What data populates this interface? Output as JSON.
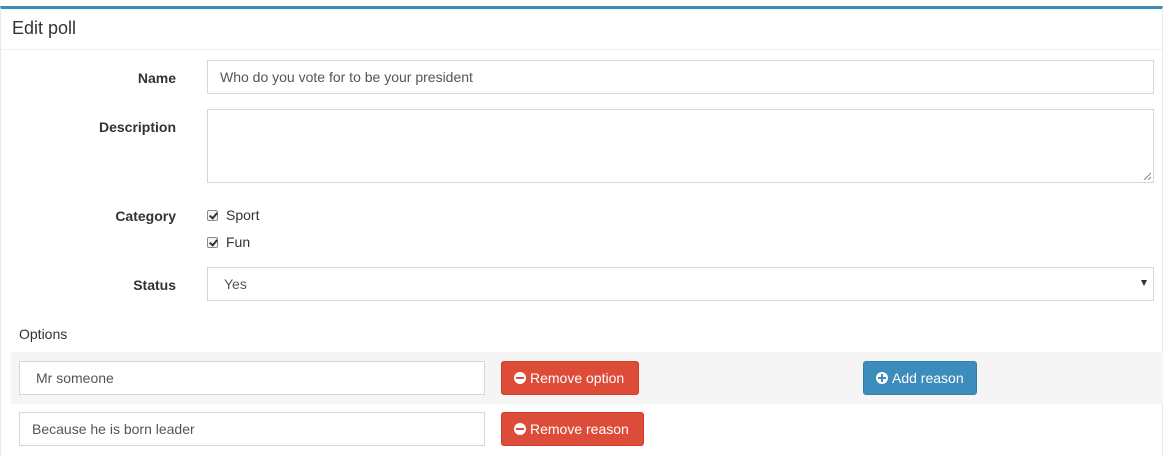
{
  "box": {
    "title": "Edit poll"
  },
  "form": {
    "name": {
      "label": "Name",
      "value": "Who do you vote for to be your president"
    },
    "description": {
      "label": "Description",
      "value": ""
    },
    "category": {
      "label": "Category",
      "options": [
        {
          "label": "Sport",
          "checked": true
        },
        {
          "label": "Fun",
          "checked": true
        }
      ]
    },
    "status": {
      "label": "Status",
      "selected": "Yes"
    }
  },
  "options_section": {
    "title": "Options",
    "items": [
      {
        "value": "Mr someone",
        "remove_label": "Remove option",
        "add_reason_label": "Add reason",
        "reasons": [
          {
            "value": "Because he is born leader",
            "remove_label": "Remove reason"
          }
        ]
      }
    ]
  },
  "colors": {
    "accent": "#3c8dbc",
    "danger": "#dd4b39",
    "primary": "#3c8dbc"
  },
  "icons": {
    "remove": "minus-circle-icon",
    "add": "plus-circle-icon",
    "select": "caret-down-icon"
  }
}
